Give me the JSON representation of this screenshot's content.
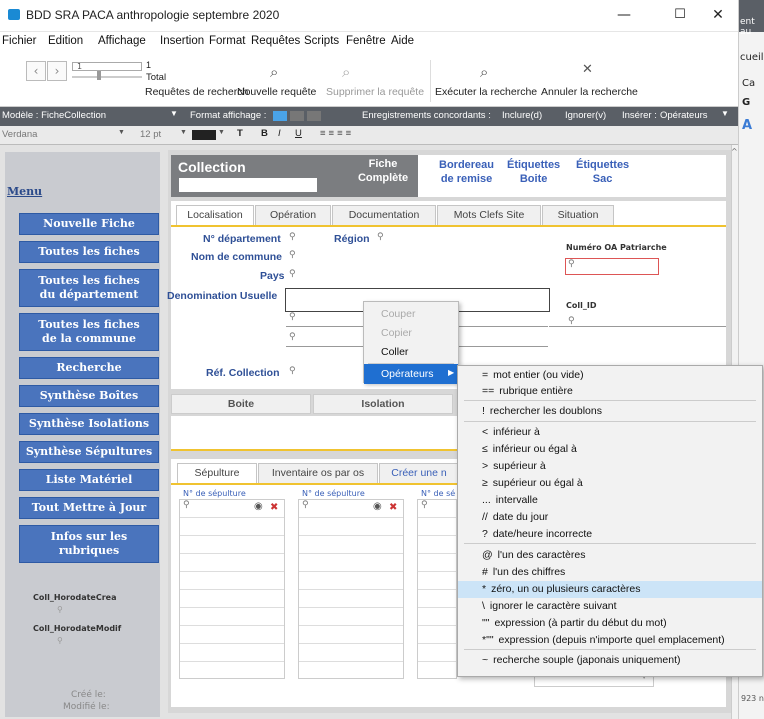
{
  "window": {
    "title": "BDD SRA PACA anthropologie septembre 2020",
    "min": "—",
    "max": "☐",
    "close": "✕"
  },
  "menu": [
    "Fichier",
    "Edition",
    "Affichage",
    "Insertion",
    "Format",
    "Requêtes",
    "Scripts",
    "Fenêtre",
    "Aide"
  ],
  "toolbar": {
    "record_num": "1",
    "total_count": "1",
    "total_label": "Total",
    "records_label": "Requêtes de recherch",
    "new_query": "Nouvelle requête",
    "delete_query": "Supprimer la requête",
    "run_search": "Exécuter la recherche",
    "cancel_search": "Annuler la recherche"
  },
  "layoutbar": {
    "model": "Modèle : FicheCollection",
    "format": "Format affichage :",
    "matching": "Enregistrements concordants :",
    "include": "Inclure(d)",
    "ignore": "Ignorer(v)",
    "insert": "Insérer :",
    "operators": "Opérateurs"
  },
  "formatbar": {
    "font": "Verdana",
    "size": "12 pt",
    "bold": "B",
    "italic": "I",
    "underline": "U"
  },
  "rightstrip": {
    "t1": "ent au",
    "t2": "cueil",
    "t3": "Ca",
    "t4": "G",
    "t5": "A",
    "t6": "923 n"
  },
  "sidebar": {
    "title": "Menu",
    "buttons": [
      "Nouvelle Fiche",
      "Toutes les fiches",
      "Toutes les fiches\ndu département",
      "Toutes les fiches\nde la commune",
      "Recherche",
      "Synthèse Boîtes",
      "Synthèse Isolations",
      "Synthèse Sépultures",
      "Liste Matériel",
      "Tout Mettre à Jour",
      "Infos sur les\nrubriques"
    ],
    "field1": "Coll_HorodateCrea",
    "field2": "Coll_HorodateModif",
    "created": "Créé le:",
    "modified": "Modifié le:"
  },
  "header": {
    "title": "Collection",
    "fiche": "Fiche\nComplète",
    "bordereau": "Bordereau\nde remise",
    "etiq_boite": "Étiquettes\nBoite",
    "etiq_sac": "Étiquettes\nSac"
  },
  "tabs": [
    "Localisation",
    "Opération",
    "Documentation",
    "Mots Clefs Site",
    "Situation"
  ],
  "fields": {
    "departement": "N° département",
    "region": "Région",
    "commune": "Nom de commune",
    "pays": "Pays",
    "denomination": "Denomination Usuelle",
    "ref": "Réf. Collection",
    "patriarche": "Numéro OA Patriarche",
    "collid": "Coll_ID"
  },
  "columns": {
    "boite": "Boite",
    "isolation": "Isolation"
  },
  "subtabs": [
    "Sépulture",
    "Inventaire os par os",
    "Créer une n"
  ],
  "subcols": [
    "N° de sépulture",
    "N° de sépulture",
    "N° de sé"
  ],
  "context": {
    "cut": "Couper",
    "copy": "Copier",
    "paste": "Coller",
    "operators": "Opérateurs"
  },
  "operators": [
    {
      "sym": "=",
      "label": "mot entier (ou vide)"
    },
    {
      "sym": "==",
      "label": "rubrique entière"
    },
    {
      "sym": "!",
      "label": "rechercher les doublons"
    },
    {
      "sym": "<",
      "label": "inférieur à"
    },
    {
      "sym": "≤",
      "label": "inférieur ou égal à"
    },
    {
      "sym": ">",
      "label": "supérieur à"
    },
    {
      "sym": "≥",
      "label": "supérieur ou égal à"
    },
    {
      "sym": "...",
      "label": "intervalle"
    },
    {
      "sym": "//",
      "label": "date du jour"
    },
    {
      "sym": "?",
      "label": "date/heure incorrecte"
    },
    {
      "sym": "@",
      "label": "l'un des caractères"
    },
    {
      "sym": "#",
      "label": "l'un des chiffres"
    },
    {
      "sym": "*",
      "label": "zéro, un ou plusieurs caractères"
    },
    {
      "sym": "\\",
      "label": "ignorer le caractère suivant"
    },
    {
      "sym": "\"\"",
      "label": "expression (à partir du début du mot)"
    },
    {
      "sym": "*\"\"",
      "label": "expression (depuis n'importe quel emplacement)"
    },
    {
      "sym": "~",
      "label": "recherche souple (japonais uniquement)"
    }
  ],
  "colors": {
    "accent": "#4a74bd",
    "header": "#7b7d80",
    "highlight": "#cce4f7"
  }
}
